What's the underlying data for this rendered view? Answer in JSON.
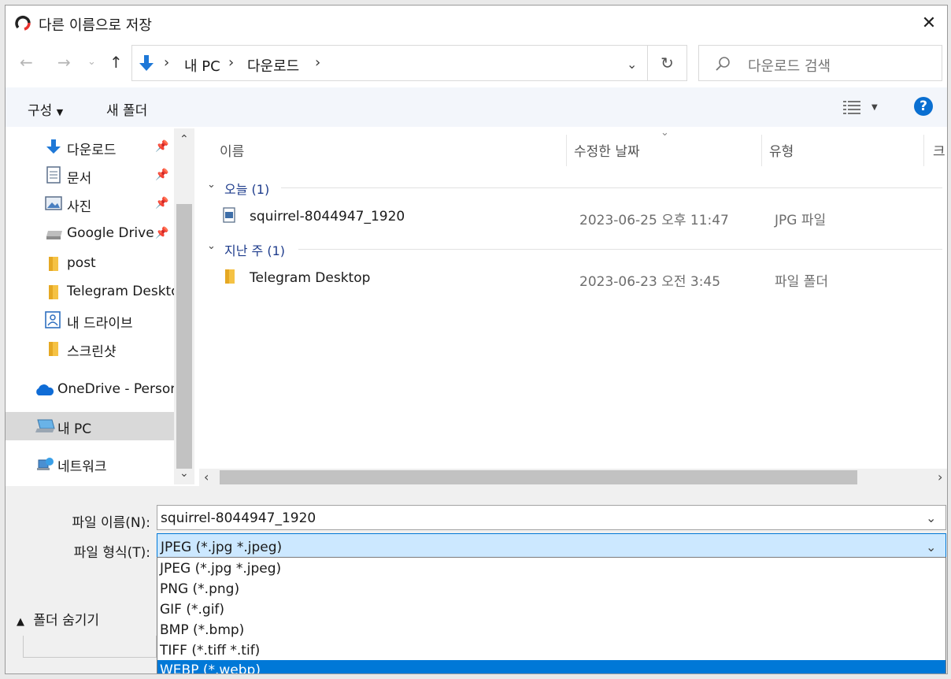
{
  "window": {
    "title": "다른 이름으로 저장"
  },
  "address": {
    "segments": [
      "내 PC",
      "다운로드"
    ]
  },
  "search": {
    "placeholder": "다운로드 검색"
  },
  "toolbar": {
    "organize": "구성",
    "new_folder": "새 폴더"
  },
  "nav": {
    "items": [
      {
        "label": "다운로드",
        "icon": "download-arrow-icon",
        "pinned": true
      },
      {
        "label": "문서",
        "icon": "document-icon",
        "pinned": true
      },
      {
        "label": "사진",
        "icon": "picture-icon",
        "pinned": true
      },
      {
        "label": "Google Drive",
        "icon": "drive-icon",
        "pinned": true
      },
      {
        "label": "post",
        "icon": "folder-icon",
        "pinned": false
      },
      {
        "label": "Telegram Deskto",
        "icon": "folder-icon",
        "pinned": false
      },
      {
        "label": "내 드라이브",
        "icon": "shortcut-icon",
        "pinned": false
      },
      {
        "label": "스크린샷",
        "icon": "folder-icon",
        "pinned": false
      },
      {
        "label": "OneDrive - Person",
        "icon": "cloud-icon",
        "pinned": false
      },
      {
        "label": "내 PC",
        "icon": "computer-icon",
        "pinned": false
      },
      {
        "label": "네트워크",
        "icon": "network-icon",
        "pinned": false
      }
    ]
  },
  "columns": {
    "name": "이름",
    "modified": "수정한 날짜",
    "type": "유형",
    "size": "크"
  },
  "groups": [
    {
      "label": "오늘 (1)",
      "files": [
        {
          "name": "squirrel-8044947_1920",
          "modified": "2023-06-25 오후 11:47",
          "type": "JPG 파일",
          "icon": "image-file-icon"
        }
      ]
    },
    {
      "label": "지난 주 (1)",
      "files": [
        {
          "name": "Telegram Desktop",
          "modified": "2023-06-23 오전 3:45",
          "type": "파일 폴더",
          "icon": "folder-icon"
        }
      ]
    }
  ],
  "form": {
    "filename_label": "파일 이름(N):",
    "filename_value": "squirrel-8044947_1920",
    "filetype_label": "파일 형식(T):",
    "filetype_value": "JPEG (*.jpg *.jpeg)",
    "filetype_options": [
      "JPEG (*.jpg *.jpeg)",
      "PNG (*.png)",
      "GIF (*.gif)",
      "BMP (*.bmp)",
      "TIFF (*.tiff *.tif)",
      "WEBP (*.webp)"
    ],
    "highlighted_option": "WEBP (*.webp)",
    "hide_folders": "폴더 숨기기"
  },
  "colors": {
    "accent": "#0078d7",
    "selection_bg": "#cce8ff",
    "group_text": "#1e3c8c",
    "download_blue": "#1e78d7"
  }
}
